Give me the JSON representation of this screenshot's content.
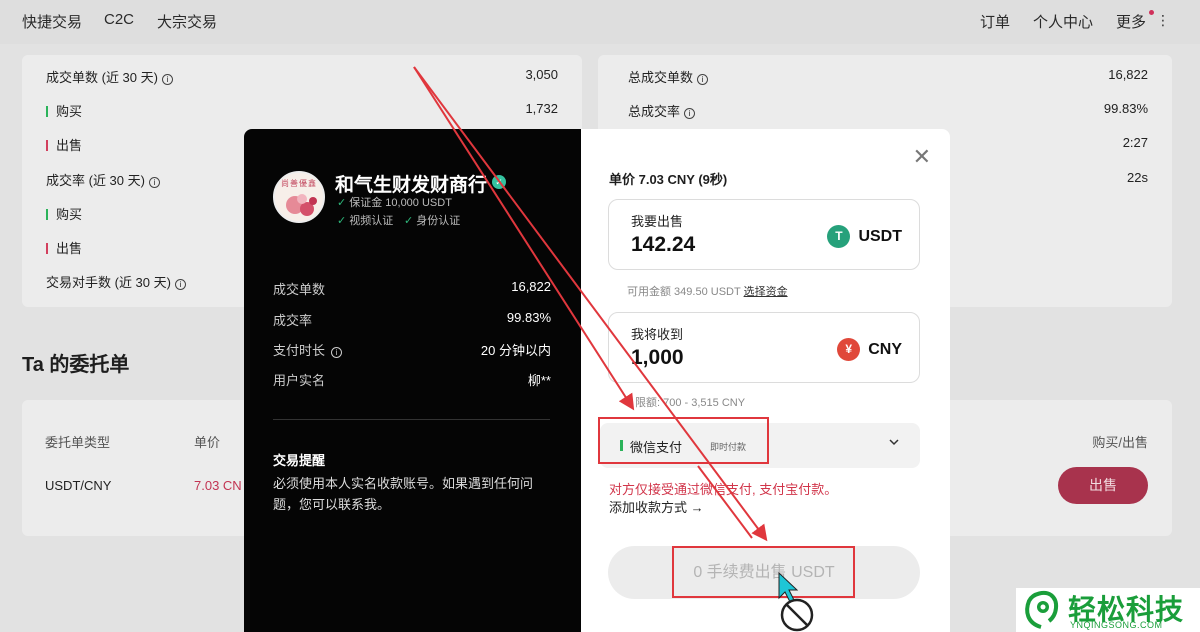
{
  "nav": {
    "left": [
      "快捷交易",
      "C2C",
      "大宗交易"
    ],
    "right": [
      "订单",
      "个人中心",
      "更多"
    ],
    "more_kebab": "⋮"
  },
  "stats_left": {
    "rows": [
      {
        "label": "成交单数 (近 30 天)",
        "value": "3,050",
        "info": true
      },
      {
        "label": "购买",
        "value": "1,732",
        "marker": "green"
      },
      {
        "label": "出售",
        "value": "",
        "marker": "red"
      },
      {
        "label": "成交率 (近 30 天)",
        "value": "",
        "info": true
      },
      {
        "label": "购买",
        "value": "",
        "marker": "green"
      },
      {
        "label": "出售",
        "value": "",
        "marker": "red"
      },
      {
        "label": "交易对手数 (近 30 天)",
        "value": "",
        "info": true
      }
    ]
  },
  "stats_right": {
    "rows": [
      {
        "label": "总成交单数",
        "value": "16,822",
        "info": true
      },
      {
        "label": "总成交率",
        "value": "99.83%",
        "info": true
      },
      {
        "label": "",
        "value": "2:27"
      },
      {
        "label": "",
        "value": "22s"
      }
    ]
  },
  "orders": {
    "title": "Ta 的委托单",
    "headers": {
      "type": "委托单类型",
      "price": "单价",
      "action": "购买/出售"
    },
    "row": {
      "type": "USDT/CNY",
      "price": "7.03 CN",
      "action": "出售"
    }
  },
  "merchant": {
    "name": "和气生财发财商行",
    "deposit": "保证金 10,000 USDT",
    "video_verify": "视频认证",
    "id_verify": "身份认证",
    "verified_icon": "✓",
    "avatar_text": "尚善優鑫"
  },
  "merchant_stats": [
    {
      "label": "成交单数",
      "value": "16,822"
    },
    {
      "label": "成交率",
      "value": "99.83%"
    },
    {
      "label": "支付时长",
      "value": "20 分钟以内",
      "info": true
    },
    {
      "label": "用户实名",
      "value": "柳**"
    }
  ],
  "reminder": {
    "title": "交易提醒",
    "lines": [
      "必须使用本人实名收款账号。如果遇到任何问",
      "题，您可以联系我。"
    ]
  },
  "trade": {
    "unit_price": "单价 7.03 CNY (9秒)",
    "sell_label": "我要出售",
    "sell_amount": "142.24",
    "sell_currency": "USDT",
    "available": "可用金额 349.50 USDT",
    "choose_funds": "选择资金",
    "receive_label": "我将收到",
    "receive_amount": "1,000",
    "receive_currency": "CNY",
    "limit": "限额: 700 - 3,515 CNY",
    "pay_method": "微信支付",
    "pay_method_sub": "即时付款",
    "warning": "对方仅接受通过微信支付, 支付宝付款。",
    "add_payment": "添加收款方式 →",
    "submit": "0 手续费出售 USDT",
    "usdt_glyph": "T",
    "cny_glyph": "¥",
    "close_glyph": "✕",
    "chevron": "⌄"
  },
  "watermark": {
    "brand": "轻松科技",
    "url": "YNQINGSONG.COM"
  },
  "colors": {
    "accent_red": "#d1354a",
    "annotation_red": "#e0373d",
    "usdt": "#26a17b",
    "cny": "#e0483a",
    "green": "#2bb35a"
  }
}
